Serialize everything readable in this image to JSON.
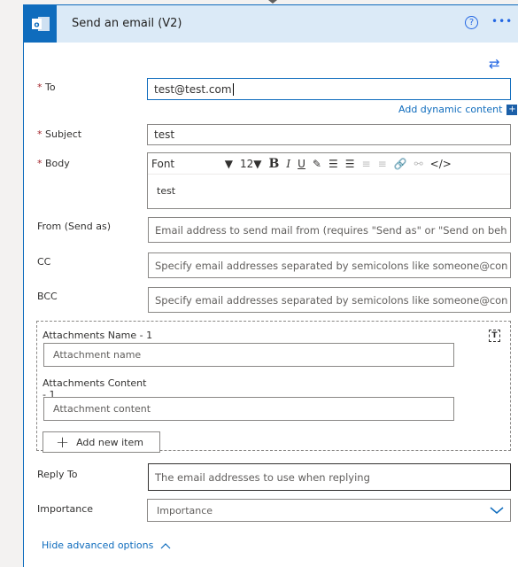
{
  "header": {
    "title": "Send an email (V2)",
    "help_icon": "help-circle-icon",
    "more_icon": "ellipsis-icon",
    "logo_icon": "outlook-icon",
    "accent": "#0f6cbd",
    "header_bg": "#dbeaf7"
  },
  "to": {
    "label": "To",
    "value": "test@test.com"
  },
  "dynamic_content": "Add dynamic content",
  "subject": {
    "label": "Subject",
    "value": "test"
  },
  "body": {
    "label": "Body",
    "font": "Font",
    "size": "12",
    "text": "test"
  },
  "from": {
    "label": "From (Send as)",
    "placeholder": "Email address to send mail from (requires \"Send as\" or \"Send on beh"
  },
  "cc": {
    "label": "CC",
    "placeholder": "Specify email addresses separated by semicolons like someone@con"
  },
  "bcc": {
    "label": "BCC",
    "placeholder": "Specify email addresses separated by semicolons like someone@con"
  },
  "attachments": {
    "name_label": "Attachments Name - 1",
    "name_placeholder": "Attachment name",
    "content_label": "Attachments Content - 1",
    "content_placeholder": "Attachment content",
    "add_label": "Add new item"
  },
  "reply_to": {
    "label": "Reply To",
    "placeholder": "The email addresses to use when replying"
  },
  "importance": {
    "label": "Importance",
    "value": "Importance"
  },
  "hide_advanced": "Hide advanced options"
}
